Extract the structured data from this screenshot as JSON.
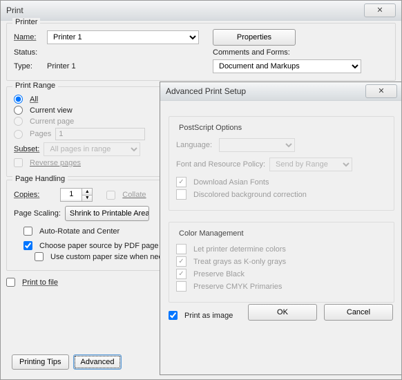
{
  "window": {
    "title": "Print"
  },
  "printer": {
    "group_label": "Printer",
    "name_label": "Name:",
    "name_value": "Printer 1",
    "status_label": "Status:",
    "status_value": "",
    "type_label": "Type:",
    "type_value": "Printer 1",
    "properties_btn": "Properties",
    "comments_label": "Comments and Forms:",
    "comments_value": "Document and Markups"
  },
  "range": {
    "group_label": "Print Range",
    "all": "All",
    "current_view": "Current view",
    "current_page": "Current page",
    "pages": "Pages",
    "pages_value": "1",
    "subset_label": "Subset:",
    "subset_value": "All pages in range",
    "reverse": "Reverse pages"
  },
  "handling": {
    "group_label": "Page Handling",
    "copies_label": "Copies:",
    "copies_value": "1",
    "collate": "Collate",
    "scaling_label": "Page Scaling:",
    "scaling_value": "Shrink to Printable Area",
    "auto_rotate": "Auto-Rotate and Center",
    "choose_paper": "Choose paper source by PDF page size",
    "use_custom": "Use custom paper size when needed"
  },
  "print_to_file": "Print to file",
  "footer": {
    "tips": "Printing Tips",
    "advanced": "Advanced"
  },
  "adv": {
    "title": "Advanced Print Setup",
    "ps": {
      "group": "PostScript Options",
      "language": "Language:",
      "font_policy": "Font and Resource Policy:",
      "font_policy_value": "Send by Range",
      "download_asian": "Download Asian Fonts",
      "discolored": "Discolored background correction"
    },
    "color": {
      "group": "Color Management",
      "let_printer": "Let printer determine colors",
      "treat_gray": "Treat grays as K-only grays",
      "preserve_black": "Preserve Black",
      "preserve_cmyk": "Preserve CMYK Primaries"
    },
    "print_as_image": "Print as image",
    "ok": "OK",
    "cancel": "Cancel"
  }
}
